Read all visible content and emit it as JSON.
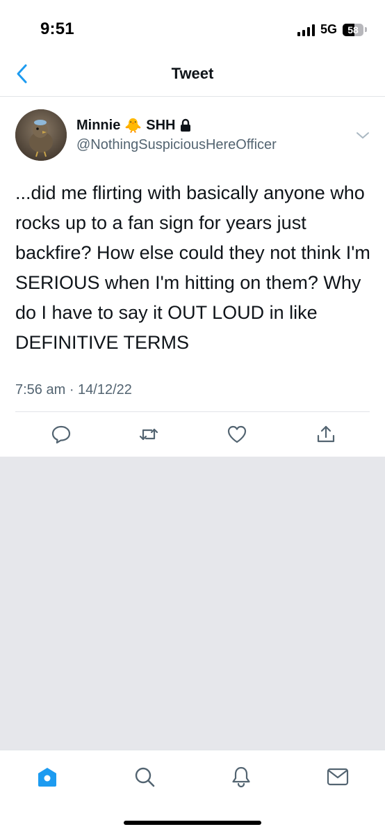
{
  "status_bar": {
    "time": "9:51",
    "network": "5G",
    "battery": "58",
    "battery_level_percent": 58
  },
  "header": {
    "back_icon": "chevron-left-icon",
    "title": "Tweet"
  },
  "tweet": {
    "display_name_part1": "Minnie",
    "display_name_emoji": "🐥",
    "display_name_part2": "SHH",
    "protected_icon": "lock-icon",
    "handle": "@NothingSuspiciousHereOfficer",
    "text": "...did me flirting with basically anyone who rocks up to a fan sign for years just backfire? How else could they not think I'm SERIOUS when I'm hitting on them? Why do I have to say it OUT LOUD in like DEFINITIVE TERMS",
    "timestamp": "7:56 am · 14/12/22"
  },
  "actions": [
    {
      "icon": "reply-icon"
    },
    {
      "icon": "retweet-icon"
    },
    {
      "icon": "like-icon"
    },
    {
      "icon": "share-icon"
    }
  ],
  "bottom_nav": [
    {
      "icon": "home-icon",
      "active": true
    },
    {
      "icon": "search-icon",
      "active": false
    },
    {
      "icon": "notifications-icon",
      "active": false
    },
    {
      "icon": "messages-icon",
      "active": false
    }
  ],
  "colors": {
    "accent": "#1D9BF0",
    "text_primary": "#0F1419",
    "text_secondary": "#536471",
    "icon_gray": "#536471",
    "background_gray": "#E6E7EB",
    "divider": "#E1E4E8"
  }
}
